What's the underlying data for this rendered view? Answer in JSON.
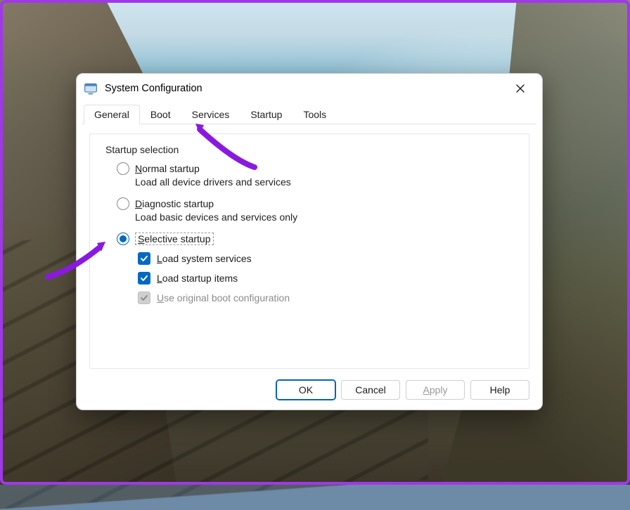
{
  "window": {
    "title": "System Configuration"
  },
  "tabs": [
    {
      "label": "General",
      "active": true
    },
    {
      "label": "Boot",
      "active": false
    },
    {
      "label": "Services",
      "active": false
    },
    {
      "label": "Startup",
      "active": false
    },
    {
      "label": "Tools",
      "active": false
    }
  ],
  "group_label": "Startup selection",
  "options": {
    "normal": {
      "accel": "N",
      "rest": "ormal startup",
      "desc": "Load all device drivers and services",
      "selected": false
    },
    "diagnostic": {
      "accel": "D",
      "rest": "iagnostic startup",
      "desc": "Load basic devices and services only",
      "selected": false
    },
    "selective": {
      "accel": "S",
      "rest": "elective startup",
      "selected": true,
      "sub": {
        "load_system_services": {
          "accel": "L",
          "rest": "oad system services",
          "checked": true,
          "enabled": true
        },
        "load_startup_items": {
          "accel": "L",
          "rest": "oad startup items",
          "checked": true,
          "enabled": true
        },
        "use_original_boot": {
          "accel": "U",
          "rest": "se original boot configuration",
          "checked": true,
          "enabled": false
        }
      }
    }
  },
  "buttons": {
    "ok": "OK",
    "cancel": "Cancel",
    "apply": {
      "accel": "A",
      "rest": "pply",
      "enabled": false
    },
    "help": "Help"
  }
}
